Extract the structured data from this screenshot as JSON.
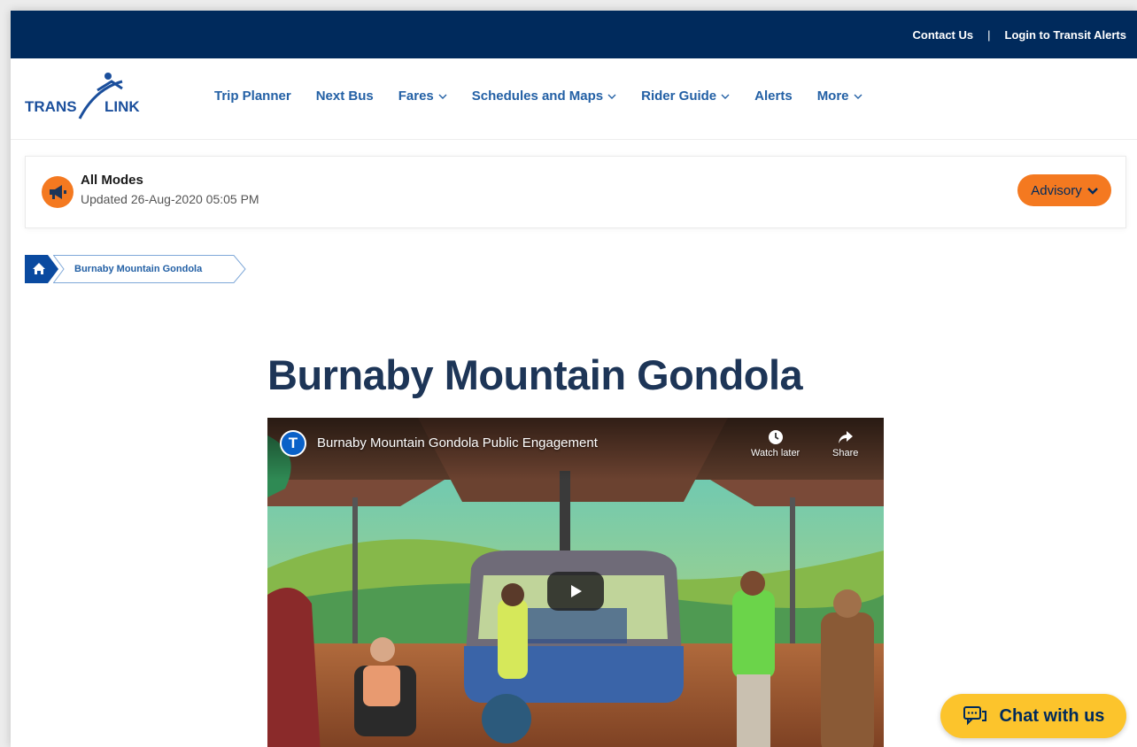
{
  "utility": {
    "contact_label": "Contact Us",
    "separator": "|",
    "login_label": "Login to Transit Alerts"
  },
  "logo": {
    "text_left": "TRANS",
    "text_right": "LINK"
  },
  "nav": {
    "items": [
      {
        "label": "Trip Planner",
        "dropdown": false
      },
      {
        "label": "Next Bus",
        "dropdown": false
      },
      {
        "label": "Fares",
        "dropdown": true
      },
      {
        "label": "Schedules and Maps",
        "dropdown": true
      },
      {
        "label": "Rider Guide",
        "dropdown": true
      },
      {
        "label": "Alerts",
        "dropdown": false
      },
      {
        "label": "More",
        "dropdown": true
      }
    ]
  },
  "alert": {
    "title": "All Modes",
    "updated": "Updated 26-Aug-2020 05:05 PM",
    "advisory_label": "Advisory",
    "icon": "megaphone-icon",
    "accent": "#f47920"
  },
  "breadcrumb": {
    "home_icon": "home-icon",
    "current": "Burnaby Mountain Gondola"
  },
  "page": {
    "title": "Burnaby Mountain Gondola"
  },
  "video": {
    "channel_letter": "T",
    "title": "Burnaby Mountain Gondola Public Engagement",
    "watch_later": "Watch later",
    "share": "Share"
  },
  "chat": {
    "label": "Chat with us"
  },
  "colors": {
    "navy": "#002a5c",
    "link_blue": "#2360a5",
    "orange": "#f47920",
    "yellow": "#fcc42c"
  }
}
